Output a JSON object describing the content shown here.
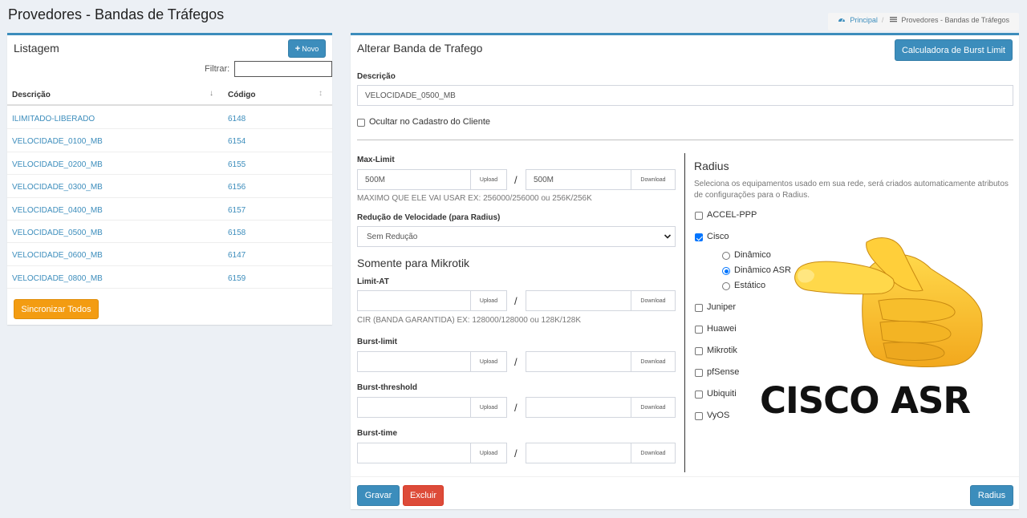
{
  "page": {
    "title": "Provedores - Bandas de Tráfegos"
  },
  "breadcrumb": {
    "home": "Principal",
    "current": "Provedores - Bandas de Tráfegos"
  },
  "listing": {
    "title": "Listagem",
    "new_button": "Novo",
    "filter_label": "Filtrar:",
    "filter_value": "",
    "columns": [
      "Descrição",
      "Código"
    ],
    "rows": [
      {
        "descricao": "ILIMITADO-LIBERADO",
        "codigo": "6148"
      },
      {
        "descricao": "VELOCIDADE_0100_MB",
        "codigo": "6154"
      },
      {
        "descricao": "VELOCIDADE_0200_MB",
        "codigo": "6155"
      },
      {
        "descricao": "VELOCIDADE_0300_MB",
        "codigo": "6156"
      },
      {
        "descricao": "VELOCIDADE_0400_MB",
        "codigo": "6157"
      },
      {
        "descricao": "VELOCIDADE_0500_MB",
        "codigo": "6158"
      },
      {
        "descricao": "VELOCIDADE_0600_MB",
        "codigo": "6147"
      },
      {
        "descricao": "VELOCIDADE_0800_MB",
        "codigo": "6159"
      }
    ],
    "sync_button": "Sincronizar Todos"
  },
  "edit": {
    "title": "Alterar Banda de Trafego",
    "burst_calc_button": "Calculadora de Burst Limit",
    "descricao_label": "Descrição",
    "descricao_value": "VELOCIDADE_0500_MB",
    "hide_label": "Ocultar no Cadastro do Cliente",
    "hide_checked": false,
    "max_limit": {
      "label": "Max-Limit",
      "upload_value": "500M",
      "download_value": "500M",
      "help": "MAXIMO QUE ELE VAI USAR EX: 256000/256000 ou 256K/256K"
    },
    "upload_addon": "Upload",
    "download_addon": "Download",
    "slash": "/",
    "reducao": {
      "label": "Redução de Velocidade (para Radius)",
      "selected": "Sem Redução"
    },
    "mikrotik_title": "Somente para Mikrotik",
    "limit_at": {
      "label": "Limit-AT",
      "upload_value": "",
      "download_value": "",
      "help": "CIR (BANDA GARANTIDA) EX: 128000/128000 ou 128K/128K"
    },
    "burst_limit": {
      "label": "Burst-limit",
      "upload_value": "",
      "download_value": ""
    },
    "burst_threshold": {
      "label": "Burst-threshold",
      "upload_value": "",
      "download_value": ""
    },
    "burst_time": {
      "label": "Burst-time",
      "upload_value": "",
      "download_value": ""
    },
    "radius": {
      "title": "Radius",
      "description": "Seleciona os equipamentos usado em sua rede, será criados automaticamente atributos de configurações para o Radius.",
      "equipment": [
        {
          "label": "ACCEL-PPP",
          "checked": false
        },
        {
          "label": "Cisco",
          "checked": true
        },
        {
          "label": "Juniper",
          "checked": false
        },
        {
          "label": "Huawei",
          "checked": false
        },
        {
          "label": "Mikrotik",
          "checked": false
        },
        {
          "label": "pfSense",
          "checked": false
        },
        {
          "label": "Ubiquiti",
          "checked": false
        },
        {
          "label": "VyOS",
          "checked": false
        }
      ],
      "cisco_modes": [
        {
          "label": "Dinâmico",
          "checked": false
        },
        {
          "label": "Dinâmico ASR",
          "checked": true
        },
        {
          "label": "Estático",
          "checked": false
        }
      ]
    },
    "save_button": "Gravar",
    "delete_button": "Excluir",
    "radius_button": "Radius"
  },
  "overlay": {
    "text": "CISCO ASR",
    "pointer_icon": "pointing-hand-emoji"
  },
  "colors": {
    "primary": "#3c8dbc",
    "danger": "#dd4b39",
    "warning": "#f39c12",
    "background": "#ecf0f5"
  }
}
